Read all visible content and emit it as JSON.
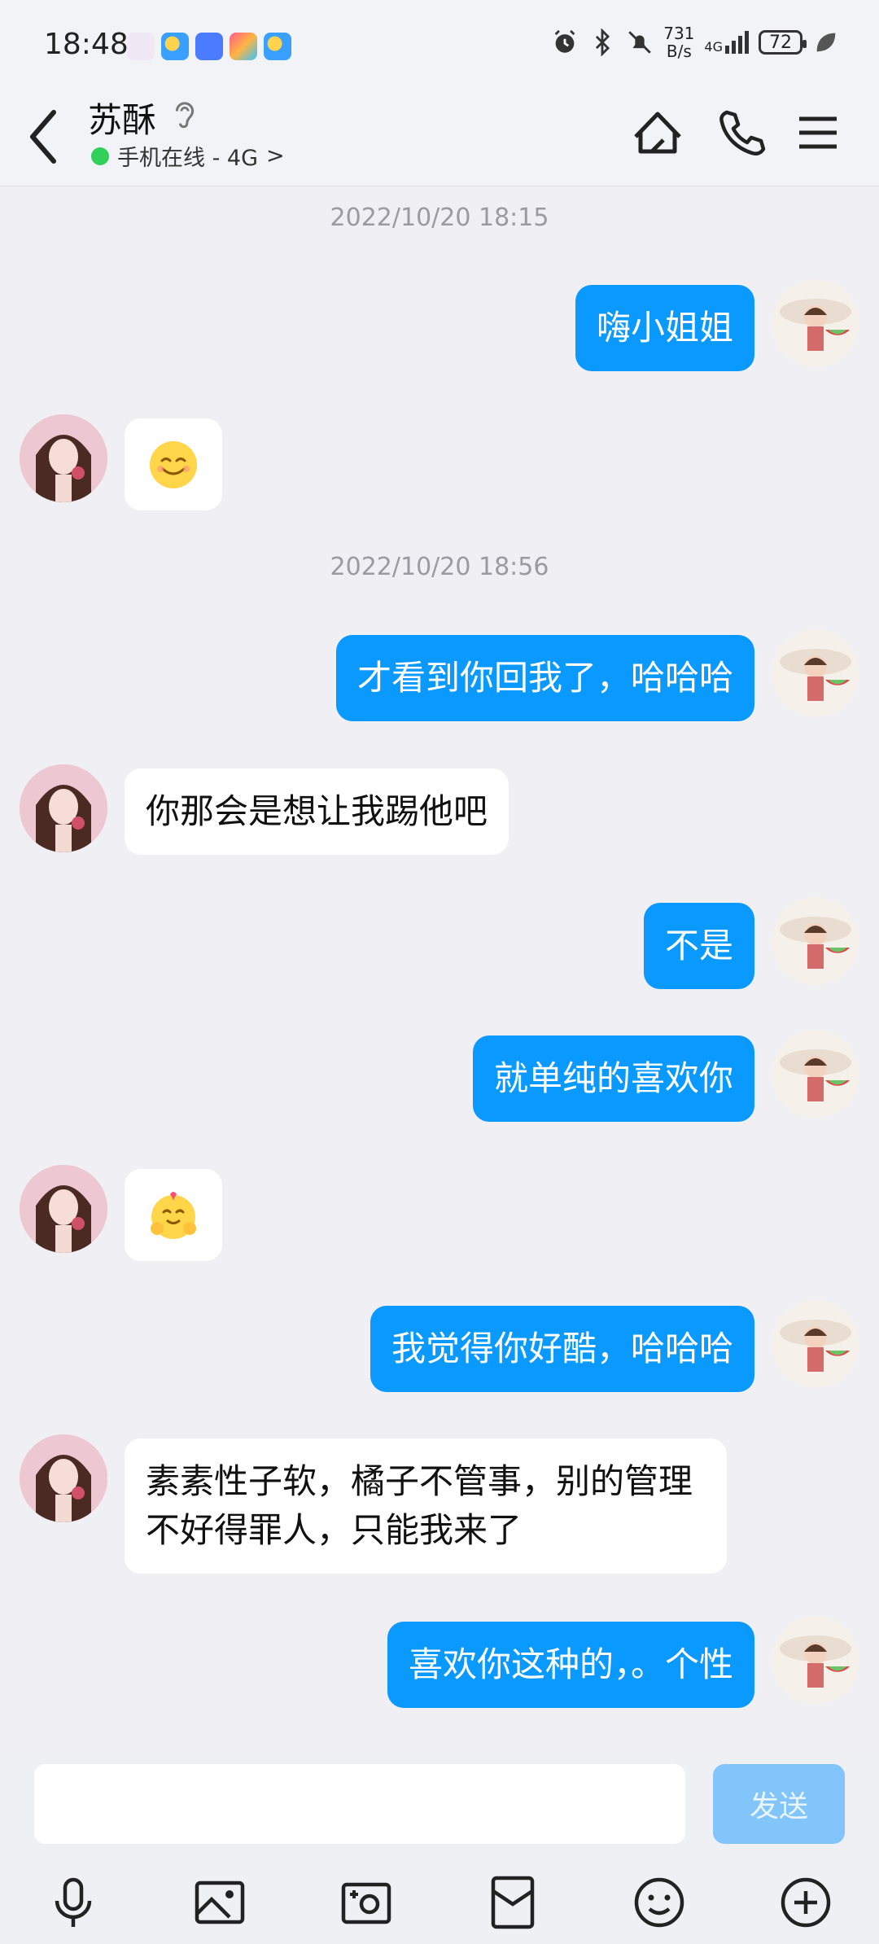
{
  "status_bar": {
    "time": "18:48",
    "net_speed_top": "731",
    "net_speed_unit": "B/s",
    "network": "4G",
    "battery": "72"
  },
  "header": {
    "contact_name": "苏酥",
    "online_status": "手机在线 - 4G",
    "chevron": ">"
  },
  "messages": [
    {
      "type": "time",
      "text": "2022/10/20 18:15"
    },
    {
      "type": "me",
      "text": "嗨小姐姐"
    },
    {
      "type": "her",
      "emoji": "😊"
    },
    {
      "type": "time",
      "text": "2022/10/20 18:56"
    },
    {
      "type": "me",
      "text": "才看到你回我了，哈哈哈"
    },
    {
      "type": "her",
      "text": "你那会是想让我踢他吧"
    },
    {
      "type": "me",
      "text": "不是"
    },
    {
      "type": "me",
      "text": "就单纯的喜欢你"
    },
    {
      "type": "her",
      "emoji": "🤗"
    },
    {
      "type": "me",
      "text": "我觉得你好酷，哈哈哈"
    },
    {
      "type": "her",
      "text": "素素性子软，橘子不管事，别的管理不好得罪人，只能我来了"
    },
    {
      "type": "me",
      "text": "喜欢你这种的，。个性"
    }
  ],
  "input": {
    "placeholder": "",
    "send_label": "发送"
  },
  "toolbar": [
    "microphone-icon",
    "image-icon",
    "camera-icon",
    "red-packet-icon",
    "emoji-icon",
    "plus-icon"
  ]
}
